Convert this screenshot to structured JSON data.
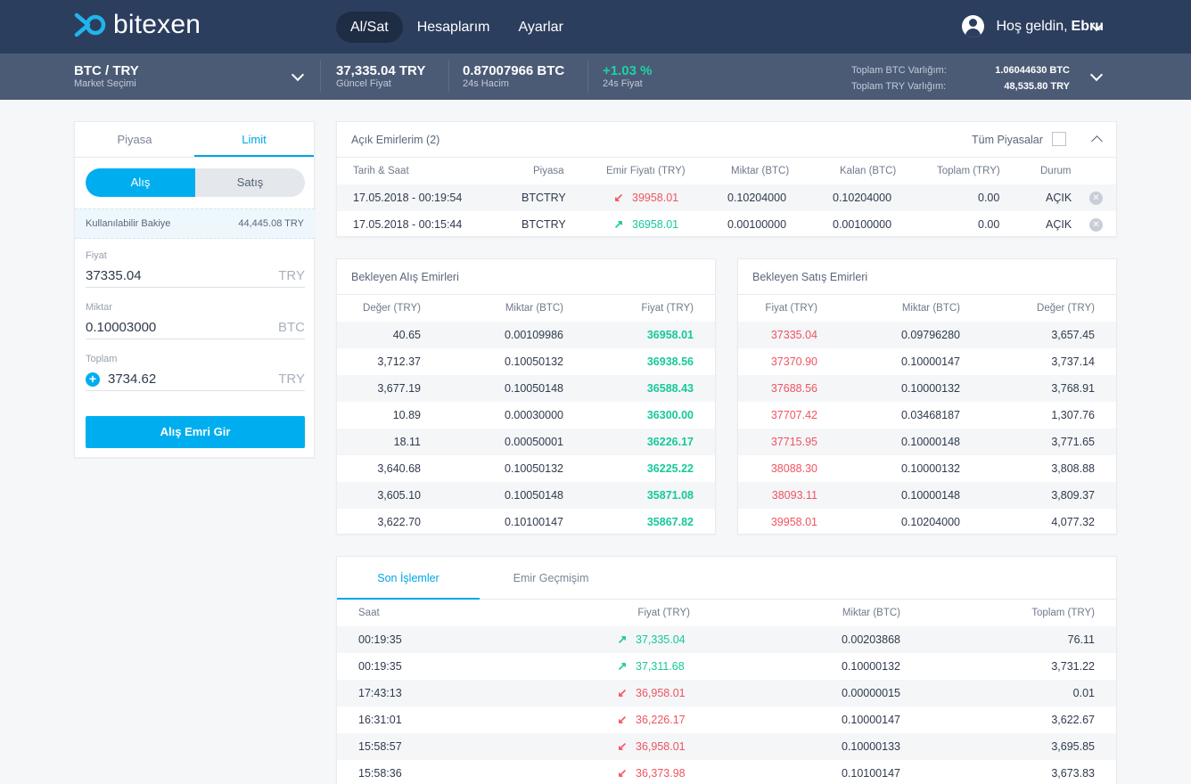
{
  "nav": {
    "brand": "bitexen",
    "links": [
      "Al/Sat",
      "Hesaplarım",
      "Ayarlar"
    ],
    "greeting": "Hoş geldin,",
    "user_name": "Ebru"
  },
  "market": {
    "pair": "BTC / TRY",
    "pair_sub": "Market Seçimi",
    "price": "37,335.04 TRY",
    "price_label": "Güncel Fiyat",
    "volume": "0.87007966 BTC",
    "volume_label": "24s Hacim",
    "change": "+1.03 %",
    "change_label": "24s Fiyat",
    "btc_balance_label": "Toplam BTC Varlığım:",
    "btc_balance": "1.06044630 BTC",
    "try_balance_label": "Toplam TRY Varlığım:",
    "try_balance": "48,535.80 TRY"
  },
  "order_form": {
    "tabs": [
      "Piyasa",
      "Limit"
    ],
    "sides": [
      "Alış",
      "Satış"
    ],
    "available_label": "Kullanılabilir Bakiye",
    "available_value": "44,445.08 TRY",
    "price_label": "Fiyat",
    "price_value": "37335.04",
    "price_unit": "TRY",
    "amount_label": "Miktar",
    "amount_value": "0.10003000",
    "amount_unit": "BTC",
    "total_label": "Toplam",
    "total_value": "3734.62",
    "total_unit": "TRY",
    "submit": "Alış Emri Gir"
  },
  "open_orders": {
    "title": "Açık Emirlerim (2)",
    "all_markets": "Tüm Piyasalar",
    "headers": [
      "Tarih & Saat",
      "Piyasa",
      "Emir Fiyatı (TRY)",
      "Miktar (BTC)",
      "Kalan (BTC)",
      "Toplam (TRY)",
      "Durum"
    ],
    "rows": [
      {
        "date": "17.05.2018 - 00:19:54",
        "market": "BTCTRY",
        "dir": "down",
        "price": "39958.01",
        "amount": "0.10204000",
        "remaining": "0.10204000",
        "total": "0.00",
        "status": "AÇIK"
      },
      {
        "date": "17.05.2018 - 00:15:44",
        "market": "BTCTRY",
        "dir": "up",
        "price": "36958.01",
        "amount": "0.00100000",
        "remaining": "0.00100000",
        "total": "0.00",
        "status": "AÇIK"
      }
    ]
  },
  "buy_orders": {
    "title": "Bekleyen Alış Emirleri",
    "headers": [
      "Değer (TRY)",
      "Miktar (BTC)",
      "Fiyat (TRY)"
    ],
    "rows": [
      [
        "40.65",
        "0.00109986",
        "36958.01"
      ],
      [
        "3,712.37",
        "0.10050132",
        "36938.56"
      ],
      [
        "3,677.19",
        "0.10050148",
        "36588.43"
      ],
      [
        "10.89",
        "0.00030000",
        "36300.00"
      ],
      [
        "18.11",
        "0.00050001",
        "36226.17"
      ],
      [
        "3,640.68",
        "0.10050132",
        "36225.22"
      ],
      [
        "3,605.10",
        "0.10050148",
        "35871.08"
      ],
      [
        "3,622.70",
        "0.10100147",
        "35867.82"
      ]
    ]
  },
  "sell_orders": {
    "title": "Bekleyen Satış Emirleri",
    "headers": [
      "Fiyat (TRY)",
      "Miktar (BTC)",
      "Değer (TRY)"
    ],
    "rows": [
      [
        "37335.04",
        "0.09796280",
        "3,657.45"
      ],
      [
        "37370.90",
        "0.10000147",
        "3,737.14"
      ],
      [
        "37688.56",
        "0.10000132",
        "3,768.91"
      ],
      [
        "37707.42",
        "0.03468187",
        "1,307.76"
      ],
      [
        "37715.95",
        "0.10000148",
        "3,771.65"
      ],
      [
        "38088.30",
        "0.10000132",
        "3,808.88"
      ],
      [
        "38093.11",
        "0.10000148",
        "3,809.37"
      ],
      [
        "39958.01",
        "0.10204000",
        "4,077.32"
      ]
    ]
  },
  "trades": {
    "tabs": [
      "Son İşlemler",
      "Emir Geçmişim"
    ],
    "headers": [
      "Saat",
      "Fiyat (TRY)",
      "Miktar (BTC)",
      "Toplam (TRY)"
    ],
    "rows": [
      {
        "time": "00:19:35",
        "dir": "up",
        "price": "37,335.04",
        "amount": "0.00203868",
        "total": "76.11"
      },
      {
        "time": "00:19:35",
        "dir": "up",
        "price": "37,311.68",
        "amount": "0.10000132",
        "total": "3,731.22"
      },
      {
        "time": "17:43:13",
        "dir": "down",
        "price": "36,958.01",
        "amount": "0.00000015",
        "total": "0.01"
      },
      {
        "time": "16:31:01",
        "dir": "down",
        "price": "36,226.17",
        "amount": "0.10000147",
        "total": "3,622.67"
      },
      {
        "time": "15:58:57",
        "dir": "down",
        "price": "36,958.01",
        "amount": "0.10000133",
        "total": "3,695.85"
      },
      {
        "time": "15:58:36",
        "dir": "down",
        "price": "36,373.98",
        "amount": "0.10100147",
        "total": "3,673.83"
      }
    ]
  },
  "colors": {
    "nav_bg": "#2c3e5e",
    "market_bg": "#4b5b76",
    "accent": "#00aeef",
    "up": "#15c99a",
    "down": "#f0545f"
  },
  "icons": {
    "logo": "bitexen-logo-icon",
    "user": "user-avatar-icon",
    "up": "arrow-up-right-icon",
    "down": "arrow-down-left-icon",
    "close": "close-circle-icon"
  }
}
